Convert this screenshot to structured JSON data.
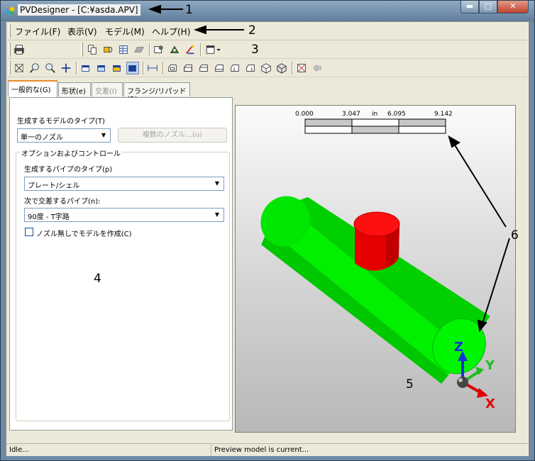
{
  "window": {
    "title": "PVDesigner - [C:¥asda.APV]",
    "minimize_glyph": "▬",
    "maximize_glyph": "□",
    "close_glyph": "✕"
  },
  "menu": {
    "items": [
      "ファイル(F)",
      "表示(V)",
      "モデル(M)",
      "ヘルプ(H)"
    ]
  },
  "toolbar1": {
    "icons": [
      "print-icon"
    ]
  },
  "toolbar2": {
    "icons": [
      "copy-icon",
      "cylinder-view-icon",
      "table-icon",
      "shade-icon",
      "properties-icon",
      "settings-icon",
      "rebuild-icon",
      "view-dropdown-icon"
    ]
  },
  "toolbar3": {
    "icons": [
      "zoom-extents-icon",
      "zoom-window-icon",
      "zoom-icon",
      "pan-icon",
      "wireframe-icon",
      "hidden-line-icon",
      "shaded-edges-icon",
      "shaded-icon",
      "dimension-icon",
      "view-front-icon",
      "view-back-icon",
      "view-top-icon",
      "view-bottom-icon",
      "view-left-icon",
      "view-right-icon",
      "view-iso-icon",
      "view-iso2-icon",
      "reset-view-icon",
      "rotate-icon"
    ]
  },
  "tabs": [
    {
      "label": "一般的な(G)",
      "state": "active"
    },
    {
      "label": "形状(e)",
      "state": "normal"
    },
    {
      "label": "交差(I)",
      "state": "disabled"
    },
    {
      "label": "フランジ/リパッド(R)",
      "state": "normal"
    }
  ],
  "form": {
    "model_type_label": "生成するモデルのタイプ(T)",
    "model_type_value": "単一のノズル",
    "multi_nozzle_button": "複数のノズル…(u)",
    "options_group_title": "オプションおよびコントロール",
    "pipe_type_label": "生成するパイプのタイプ(p)",
    "pipe_type_value": "プレート/シェル",
    "intersect_label": "次で交差するパイプ(n):",
    "intersect_value": "90度 - T字路",
    "no_nozzle_checkbox_label": "ノズル無しでモデルを作成(C)",
    "no_nozzle_checked": false
  },
  "preview": {
    "scale_labels": [
      "0.000",
      "3.047",
      "in",
      "6.095",
      "9.142"
    ],
    "axes": {
      "x": "X",
      "y": "Y",
      "z": "Z"
    },
    "colors": {
      "pipe": "#00ee00",
      "nozzle": "#ee0000",
      "axis_x": "#e00000",
      "axis_y": "#22bb22",
      "axis_z": "#1a2fd6"
    }
  },
  "status": {
    "left": "Idle...",
    "right": "Preview model is current..."
  },
  "callouts": [
    "1",
    "2",
    "3",
    "4",
    "5",
    "6"
  ]
}
